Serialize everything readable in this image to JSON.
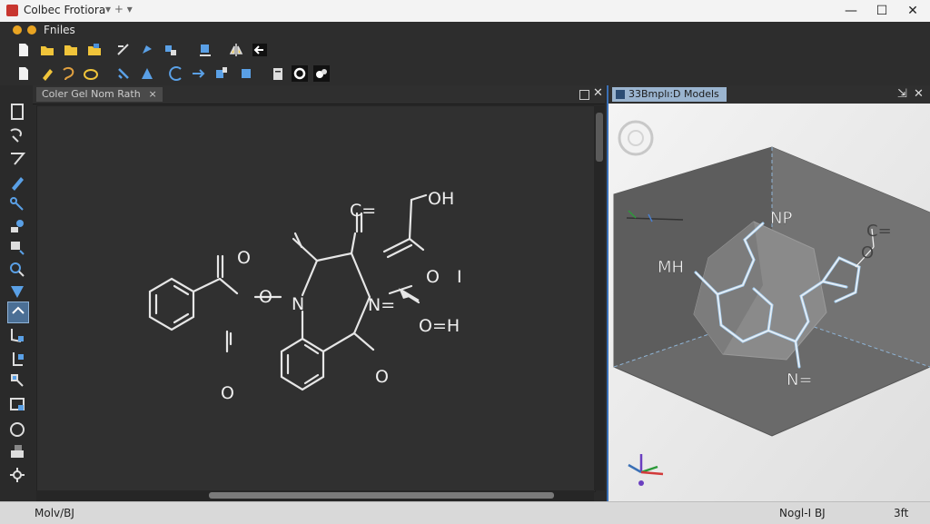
{
  "window": {
    "title": "Colbec Frotiora",
    "tab_extra": "▾  +  ▾",
    "minimize": "—",
    "maximize": "☐",
    "close": "✕"
  },
  "menubar": {
    "label": "Fniles"
  },
  "colors": {
    "accent": "#3a6fb5",
    "close_dot": "#d9a300",
    "title_icon": "#c8362f"
  },
  "panel_2d": {
    "tab_label": "Coler Gel Nom Rath",
    "tab_close": "×",
    "labels": {
      "o_top_left": "O",
      "o_ester": "O",
      "n_ring": "N",
      "o_lower_left": "O",
      "o_top_mid": "O",
      "eq_top_mid": "C=",
      "n_mid": "N=",
      "o_ring": "O",
      "oh_top": "OH",
      "oi": "O",
      "i_mark": "I",
      "oh_mid": "O=H"
    }
  },
  "panel_3d": {
    "tab_label": "33Bmplı:D Models",
    "pin": "⇲",
    "close": "✕",
    "labels": {
      "np": "NP",
      "mh": "MH",
      "c_eq": "C=",
      "o": "O",
      "n_eq": "N="
    }
  },
  "status": {
    "left": "Molv/BJ",
    "center": "Nogl-I BJ",
    "right": "3ft"
  }
}
